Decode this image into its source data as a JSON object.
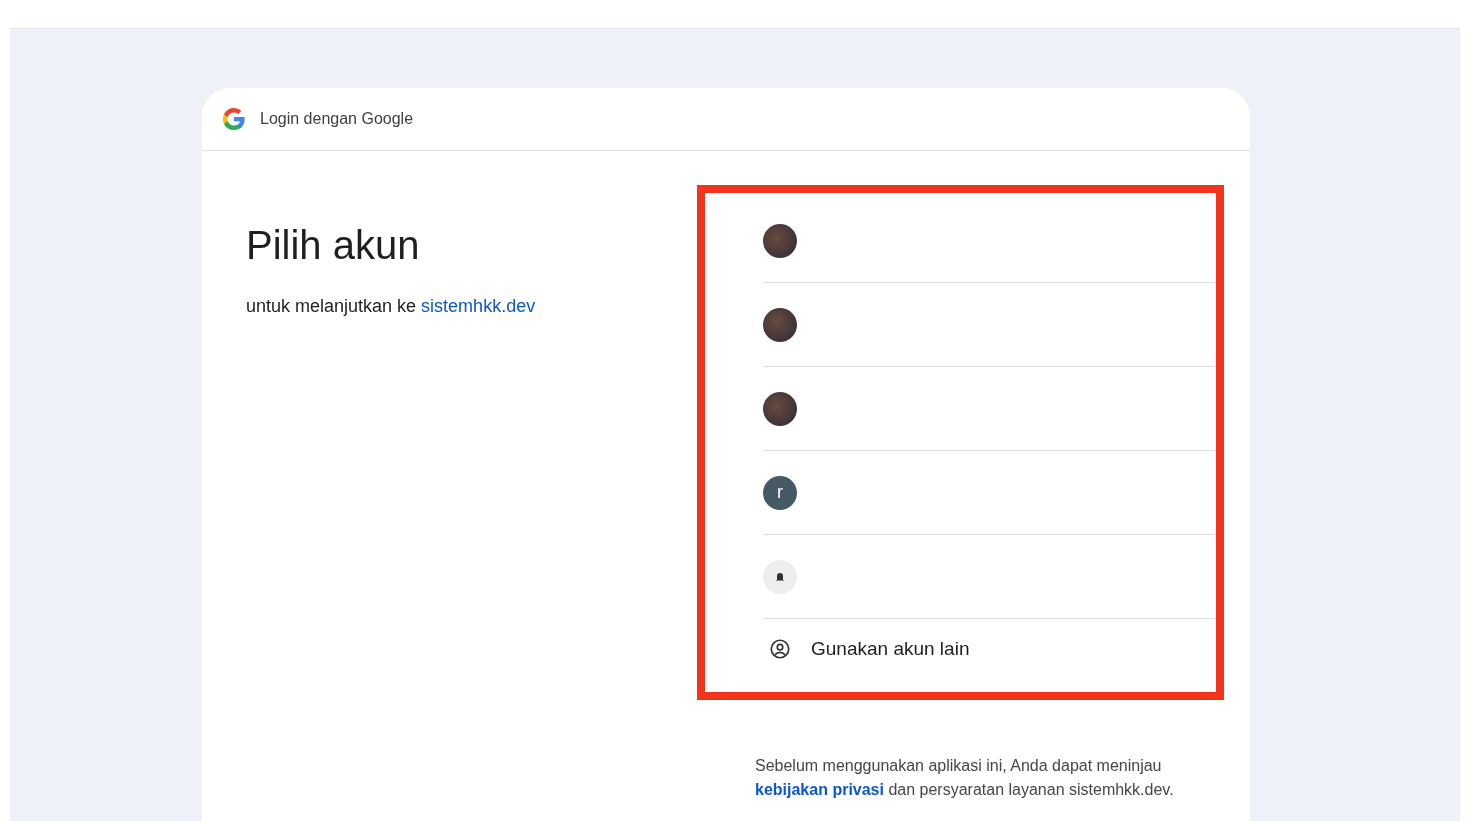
{
  "header": {
    "title": "Login dengan Google"
  },
  "heading": "Pilih akun",
  "subtitle": {
    "text": "untuk melanjutkan ke ",
    "link": "sistemhkk.dev"
  },
  "accounts_highlighted": true,
  "accounts": [
    {
      "kind": "photo"
    },
    {
      "kind": "photo"
    },
    {
      "kind": "photo"
    },
    {
      "kind": "letter",
      "letter": "r"
    },
    {
      "kind": "silhouette"
    }
  ],
  "other_account": "Gunakan akun lain",
  "notice": {
    "before": "Sebelum menggunakan aplikasi ini, Anda dapat meninjau ",
    "link": "kebijakan privasi",
    "after": " dan persyaratan layanan sistemhkk.dev."
  }
}
